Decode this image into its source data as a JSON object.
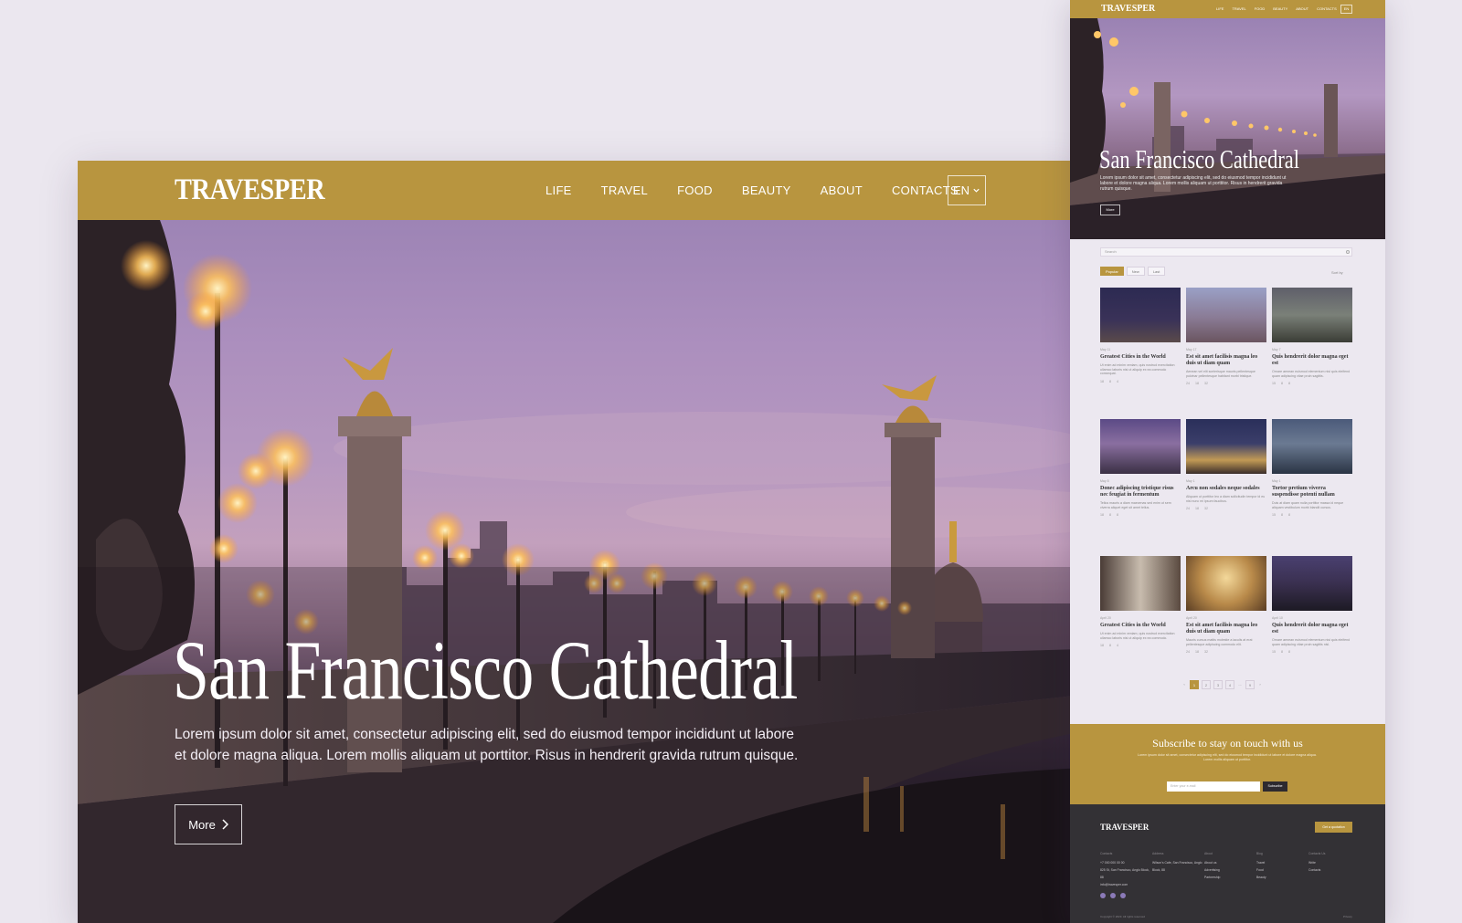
{
  "brand": "TRAVESPER",
  "nav": [
    "LIFE",
    "TRAVEL",
    "FOOD",
    "BEAUTY",
    "ABOUT",
    "CONTACTS"
  ],
  "language": "EN",
  "hero": {
    "title": "San Francisco Cathedral",
    "text": "Lorem ipsum dolor sit amet, consectetur adipiscing elit, sed do eiusmod tempor incididunt ut labore et dolore magna aliqua. Lorem mollis aliquam ut porttitor. Risus in hendrerit gravida rutrum quisque.",
    "button": "More"
  },
  "colors": {
    "accent": "#b8953f",
    "footer": "#333135",
    "page_bg": "#ebe7ef"
  },
  "mini": {
    "search_placeholder": "Search",
    "filters": [
      "Popular",
      "New",
      "Last"
    ],
    "sort": "Sort by",
    "cards": [
      {
        "date": "May 11",
        "title": "Greatest Cities in the World",
        "excerpt": "Ut enim ad minim veniam, quis nostrud exercitation ullamco laboris nisi ut aliquip ex ea commodo consequat.",
        "likes": "18",
        "comments": "8",
        "shares": "4"
      },
      {
        "date": "May 17",
        "title": "Est sit amet facilisis magna leo duis ut diam quam",
        "excerpt": "Aenean vel elit scelerisque mauris pellentesque pulvinar pellentesque habitant morbi tristique.",
        "likes": "24",
        "comments": "18",
        "shares": "32"
      },
      {
        "date": "May 7",
        "title": "Quis hendrerit dolor magna eget est",
        "excerpt": "Ornare aenean euismod elementum nisi quis eleifend quam adipiscing vitae proin sagittis.",
        "likes": "15",
        "comments": "8",
        "shares": "8"
      },
      {
        "date": "May 8",
        "title": "Donec adipiscing tristique risus nec feugiat in fermentum",
        "excerpt": "Tellus mauris a diam maecenas sed enim ut sem viverra aliquet eget sit amet tellus.",
        "likes": "18",
        "comments": "8",
        "shares": "8"
      },
      {
        "date": "May 1",
        "title": "Arcu non sodales neque sodales",
        "excerpt": "Aliquam ut porttitor leo a diam sollicitudin tempor id eu nisl nunc mi ipsum faucibus.",
        "likes": "24",
        "comments": "18",
        "shares": "32"
      },
      {
        "date": "May 1",
        "title": "Tortor pretium viverra suspendisse potenti nullam",
        "excerpt": "Duis at diam quam nulla porttitor massa id neque aliquam vestibulum morbi blandit cursus.",
        "likes": "15",
        "comments": "8",
        "shares": "8"
      },
      {
        "date": "April 20",
        "title": "Greatest Cities in the World",
        "excerpt": "Ut enim ad minim veniam, quis nostrud exercitation ullamco laboris nisi ut aliquip ex ea commodo.",
        "likes": "18",
        "comments": "8",
        "shares": "4"
      },
      {
        "date": "April 20",
        "title": "Est sit amet facilisis magna leo duis ut diam quam",
        "excerpt": "Mauris cursus mattis molestie a iaculis at erat pellentesque adipiscing commodo elit.",
        "likes": "24",
        "comments": "18",
        "shares": "32"
      },
      {
        "date": "April 10",
        "title": "Quis hendrerit dolor magna eget est",
        "excerpt": "Ornare aenean euismod elementum nisi quis eleifend quam adipiscing vitae proin sagittis nisl.",
        "likes": "15",
        "comments": "8",
        "shares": "8"
      }
    ],
    "pager": [
      "‹",
      "1",
      "2",
      "3",
      "4",
      "...",
      "9",
      "›"
    ],
    "subscribe": {
      "title": "Subscribe to stay on touch with us",
      "text": "Lorem ipsum dolor sit amet, consectetur adipiscing elit, sed do eiusmod tempor incididunt ut labore et dolore magna aliqua. Lorem mollis aliquam ut porttitor.",
      "placeholder": "Enter your e-mail",
      "button": "Subscribe"
    },
    "footer": {
      "button": "Get a quotation",
      "columns": [
        {
          "heading": "Contacts",
          "items": [
            "+7 000 000 00 00",
            "825 St, San Francisco, Anglo Block, 88",
            "info@travesper.com"
          ]
        },
        {
          "heading": "Address",
          "items": [
            "Wilson's Cafe, San Francisco, Anglo Block, 88"
          ]
        },
        {
          "heading": "About",
          "items": [
            "About us",
            "Advertising",
            "Partnership"
          ]
        },
        {
          "heading": "Blog",
          "items": [
            "Travel",
            "Food",
            "Beauty"
          ]
        },
        {
          "heading": "Contacts Us",
          "items": [
            "Write",
            "Contacts"
          ]
        }
      ],
      "copyright": "Copyright © 2023. All rights reserved",
      "privacy": "Privacy"
    }
  }
}
